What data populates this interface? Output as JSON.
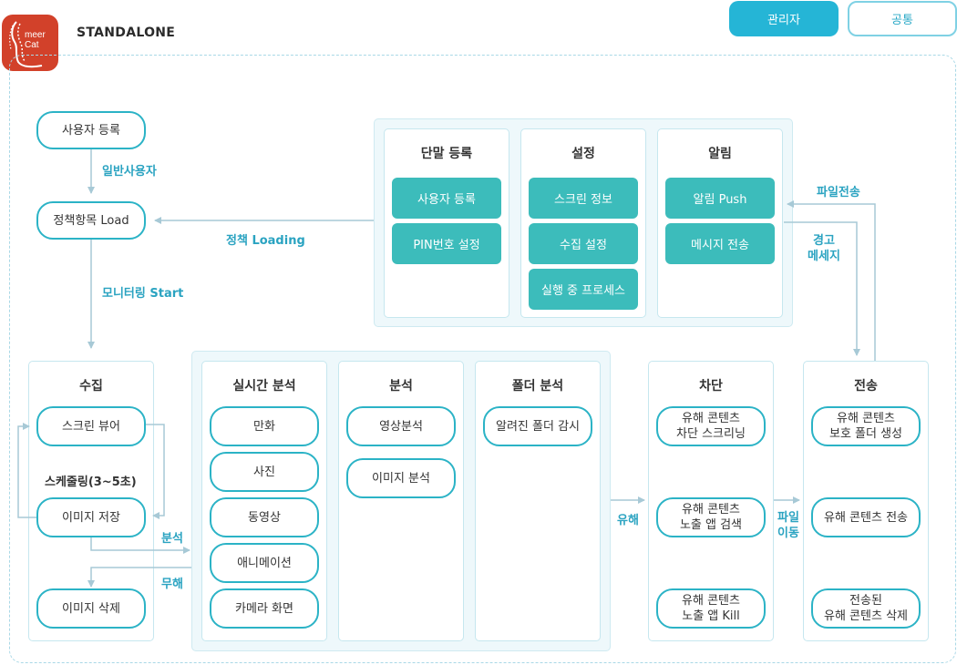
{
  "header": {
    "app_title": "STANDALONE",
    "logo_line1": "meer",
    "logo_line2": "Cat",
    "tabs": {
      "admin": "관리자",
      "common": "공통"
    }
  },
  "colors": {
    "accent": "#25b5d6",
    "teal": "#3cbcbb",
    "outline": "#2bb3c6",
    "arrow": "#a7c9d6",
    "label": "#2aa3c1"
  },
  "left_flow": {
    "user_register": "사용자 등록",
    "label_general_user": "일반사용자",
    "policy_load": "정책항목 Load",
    "label_monitoring": "모니터링 Start",
    "label_policy_loading": "정책 Loading"
  },
  "top_section": {
    "terminal": {
      "title": "단말 등록",
      "buttons": [
        "사용자 등록",
        "PIN번호 설정"
      ]
    },
    "settings": {
      "title": "설정",
      "buttons": [
        "스크린 정보",
        "수집 설정",
        "실행 중 프로세스"
      ]
    },
    "alert": {
      "title": "알림",
      "buttons": [
        "알림 Push",
        "메시지 전송"
      ]
    }
  },
  "collect": {
    "title": "수집",
    "screen_viewer": "스크린 뷰어",
    "label_schedule": "스케줄링(3~5초)",
    "image_save": "이미지 저장",
    "image_delete": "이미지 삭제",
    "label_analysis": "분석",
    "label_harmless": "무해"
  },
  "analysis": {
    "realtime": {
      "title": "실시간 분석",
      "items": [
        "만화",
        "사진",
        "동영상",
        "애니메이션",
        "카메라 화면"
      ]
    },
    "analysis": {
      "title": "분석",
      "items": [
        "영상분석",
        "이미지 분석"
      ]
    },
    "folder": {
      "title": "폴더 분석",
      "items": [
        "알려진 폴더 감시"
      ]
    }
  },
  "label_harmful": "유해",
  "block": {
    "title": "차단",
    "items": [
      "유해 콘텐츠\n차단 스크리닝",
      "유해 콘텐츠\n노출 앱 검색",
      "유해 콘텐츠\n노출 앱 Kill"
    ]
  },
  "label_file_move": "파일\n이동",
  "transfer": {
    "title": "전송",
    "items": [
      "유해 콘텐츠\n보호 폴더 생성",
      "유해 콘텐츠 전송",
      "전송된\n유해 콘텐츠 삭제"
    ]
  },
  "label_file_transfer": "파일전송",
  "label_warning_msg": "경고\n메세지"
}
